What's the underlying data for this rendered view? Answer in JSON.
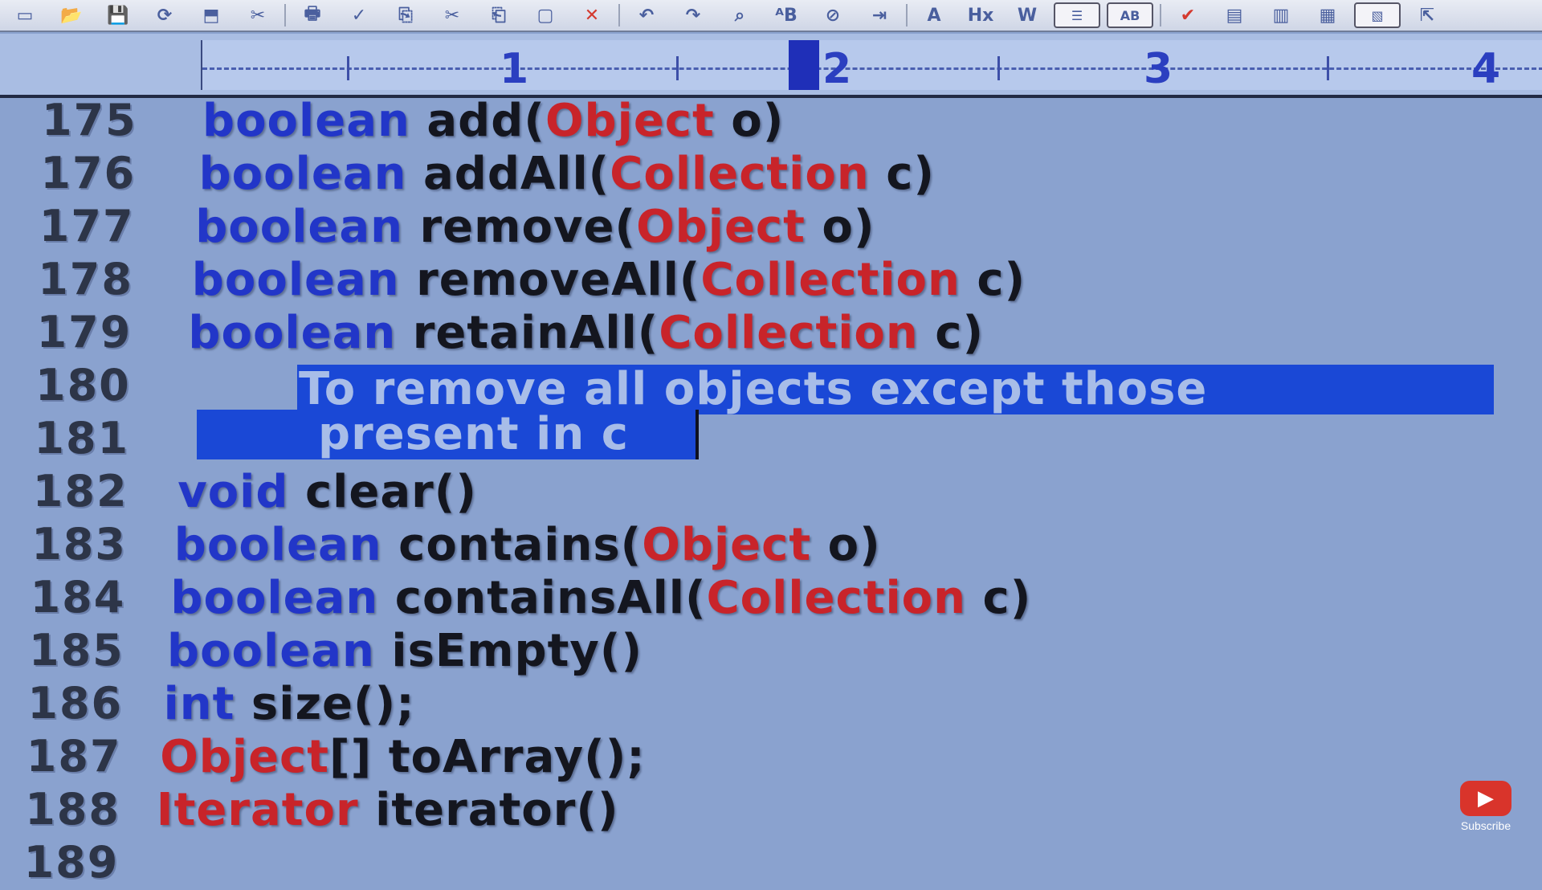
{
  "toolbar": {
    "buttons": [
      "▭",
      "📂",
      "💾",
      "⟳",
      "⬒",
      "✂",
      "🖶",
      "✓",
      "⎘",
      "✂",
      "⎗",
      "▢",
      "✕",
      "↶",
      "↷",
      "⌕",
      "ᴬB",
      "⊘",
      "⇥",
      "A",
      "Hx",
      "W",
      "☰",
      "AB",
      "✔",
      "▤",
      "▥",
      "▦",
      "▧",
      "⇱"
    ]
  },
  "ruler": {
    "numbers": [
      "1",
      "2",
      "3",
      "4"
    ]
  },
  "editor": {
    "lines": [
      {
        "num": "175",
        "parts": [
          {
            "t": "kw",
            "v": "boolean"
          },
          {
            "t": "tx",
            "v": " add("
          },
          {
            "t": "ty",
            "v": "Object"
          },
          {
            "t": "tx",
            "v": " o)"
          }
        ]
      },
      {
        "num": "176",
        "parts": [
          {
            "t": "kw",
            "v": "boolean"
          },
          {
            "t": "tx",
            "v": " addAll("
          },
          {
            "t": "ty",
            "v": "Collection"
          },
          {
            "t": "tx",
            "v": " c)"
          }
        ]
      },
      {
        "num": "177",
        "parts": [
          {
            "t": "kw",
            "v": "boolean"
          },
          {
            "t": "tx",
            "v": " remove("
          },
          {
            "t": "ty",
            "v": "Object"
          },
          {
            "t": "tx",
            "v": " o)"
          }
        ]
      },
      {
        "num": "178",
        "parts": [
          {
            "t": "kw",
            "v": "boolean"
          },
          {
            "t": "tx",
            "v": " removeAll("
          },
          {
            "t": "ty",
            "v": "Collection"
          },
          {
            "t": "tx",
            "v": " c)"
          }
        ]
      },
      {
        "num": "179",
        "parts": [
          {
            "t": "kw",
            "v": "boolean"
          },
          {
            "t": "tx",
            "v": " retainAll("
          },
          {
            "t": "ty",
            "v": "Collection"
          },
          {
            "t": "tx",
            "v": " c)"
          }
        ]
      },
      {
        "num": "180",
        "parts": []
      },
      {
        "num": "181",
        "parts": []
      },
      {
        "num": "182",
        "parts": [
          {
            "t": "kw",
            "v": "void"
          },
          {
            "t": "tx",
            "v": " clear()"
          }
        ]
      },
      {
        "num": "183",
        "parts": [
          {
            "t": "kw",
            "v": "boolean"
          },
          {
            "t": "tx",
            "v": " contains("
          },
          {
            "t": "ty",
            "v": "Object"
          },
          {
            "t": "tx",
            "v": " o)"
          }
        ]
      },
      {
        "num": "184",
        "parts": [
          {
            "t": "kw",
            "v": "boolean"
          },
          {
            "t": "tx",
            "v": " containsAll("
          },
          {
            "t": "ty",
            "v": "Collection"
          },
          {
            "t": "tx",
            "v": " c)"
          }
        ]
      },
      {
        "num": "185",
        "parts": [
          {
            "t": "kw",
            "v": "boolean"
          },
          {
            "t": "tx",
            "v": " isEmpty()"
          }
        ]
      },
      {
        "num": "186",
        "parts": [
          {
            "t": "kw",
            "v": "int"
          },
          {
            "t": "tx",
            "v": " size();"
          }
        ]
      },
      {
        "num": "187",
        "parts": [
          {
            "t": "ty",
            "v": "Object"
          },
          {
            "t": "tx",
            "v": "[]  toArray();"
          }
        ]
      },
      {
        "num": "188",
        "parts": [
          {
            "t": "ty",
            "v": "Iterator"
          },
          {
            "t": "tx",
            "v": " iterator()"
          }
        ]
      },
      {
        "num": "189",
        "parts": []
      }
    ],
    "selection": {
      "line1": "To remove all objects except those",
      "line2": "present in c"
    }
  },
  "subscribe": {
    "label": "Subscribe"
  },
  "colors": {
    "keyword": "#2236c8",
    "type": "#c8242a",
    "text": "#14161f",
    "selection": "#1a48d6",
    "background": "#8aa2cf"
  }
}
